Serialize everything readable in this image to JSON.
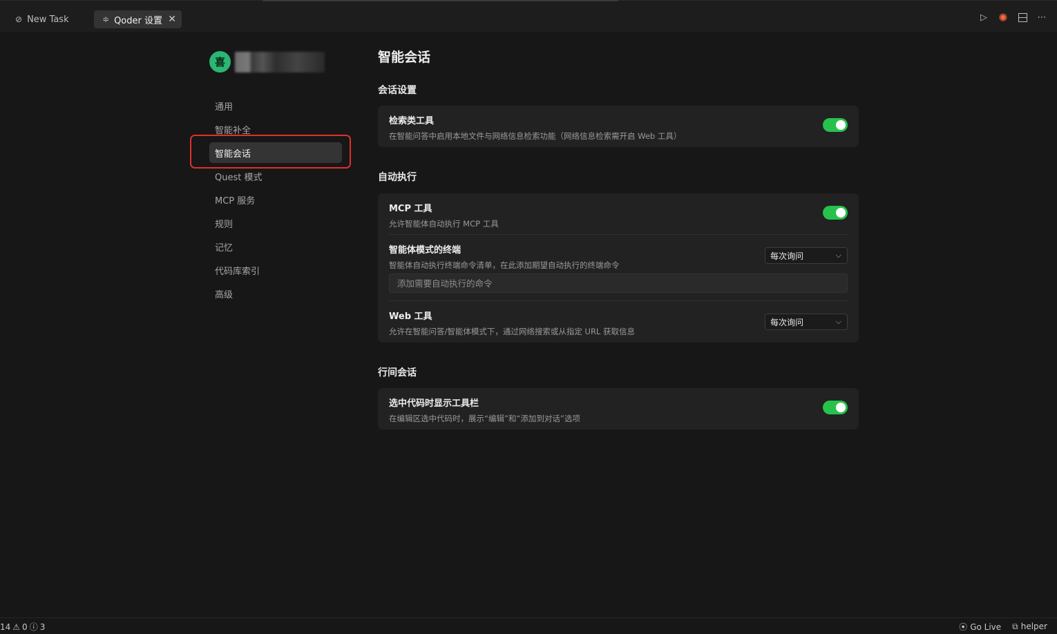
{
  "tabs": {
    "new_task": {
      "icon": "compass-icon",
      "label": "New Task"
    },
    "settings": {
      "icon": "settings-sliders-icon",
      "label": "Qoder 设置",
      "close": "✕"
    }
  },
  "toolbar": {
    "icons": [
      "run-icon",
      "spark-icon",
      "split-layout-icon",
      "more-icon"
    ]
  },
  "profile": {
    "avatar_char": "喜"
  },
  "nav": {
    "items": [
      "通用",
      "智能补全",
      "智能会话",
      "Quest 模式",
      "MCP 服务",
      "规则",
      "记忆",
      "代码库索引",
      "高级"
    ],
    "active_index": 2
  },
  "page": {
    "title": "智能会话",
    "sections": {
      "chat": {
        "title": "会话设置",
        "search_tool": {
          "title": "检索类工具",
          "desc": "在智能问答中启用本地文件与网络信息检索功能（网络信息检索需开启 Web 工具）",
          "enabled": true
        }
      },
      "auto": {
        "title": "自动执行",
        "mcp": {
          "title": "MCP 工具",
          "desc": "允许智能体自动执行 MCP 工具",
          "enabled": true
        },
        "terminal": {
          "title": "智能体模式的终端",
          "desc": "智能体自动执行终端命令清单，在此添加期望自动执行的终端命令",
          "select": "每次询问",
          "input_placeholder": "添加需要自动执行的命令"
        },
        "web": {
          "title": "Web 工具",
          "desc": "允许在智能问答/智能体模式下，通过网络搜索或从指定 URL 获取信息",
          "select": "每次询问"
        }
      },
      "inline": {
        "title": "行间会话",
        "toolbar": {
          "title": "选中代码时显示工具栏",
          "desc": "在编辑区选中代码时，展示“编辑”和“添加到对话”选项",
          "enabled": true
        }
      }
    }
  },
  "statusbar": {
    "errors": "14",
    "warnings": "0",
    "infos": "3",
    "go_live": "Go Live",
    "helper": "helper"
  },
  "colors": {
    "toggle_on": "#27c24c",
    "highlight": "#e0302c",
    "avatar": "#2bb673"
  }
}
